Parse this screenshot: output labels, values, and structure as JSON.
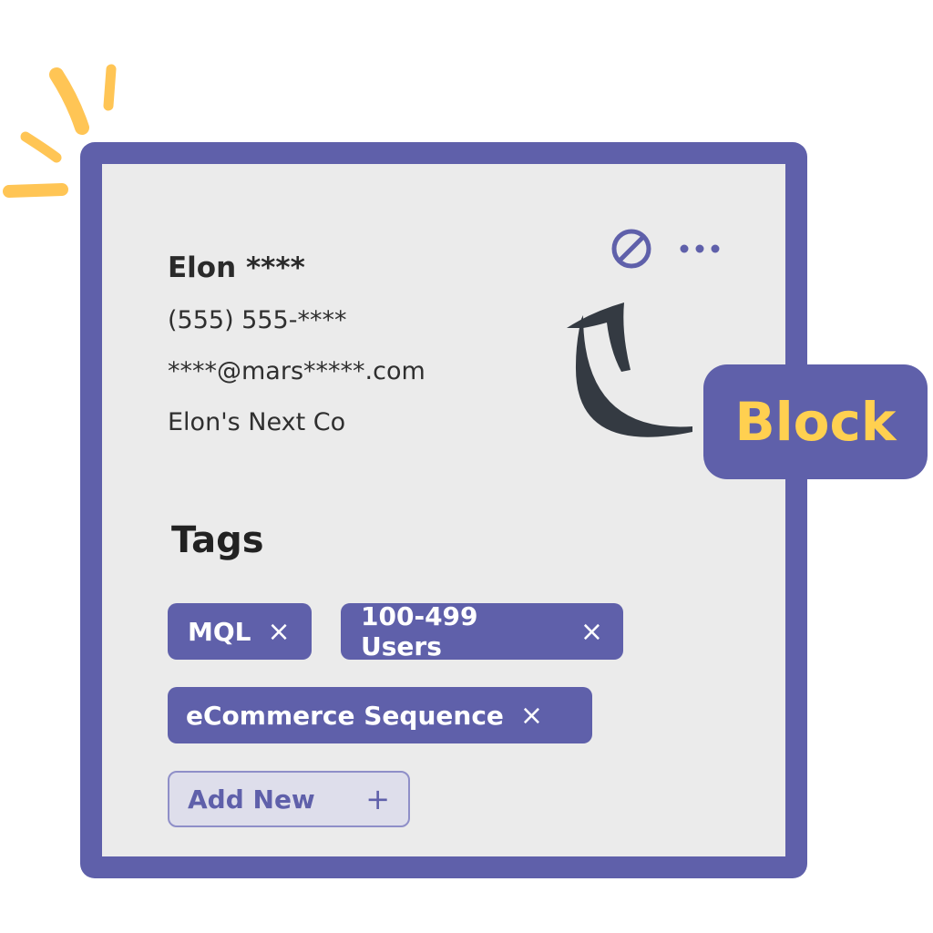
{
  "contact": {
    "name": "Elon ****",
    "phone": "(555) 555-****",
    "email": "****@mars*****.com",
    "company": "Elon's Next Co"
  },
  "actions": {
    "block_icon": "block-icon",
    "more_icon": "more-horizontal-icon"
  },
  "tags": {
    "title": "Tags",
    "items": [
      {
        "label": "MQL",
        "remove": "×"
      },
      {
        "label": "100-499 Users",
        "remove": "×"
      },
      {
        "label": "eCommerce Sequence",
        "remove": "×"
      }
    ],
    "add_label": "Add New",
    "add_icon": "+"
  },
  "callout": {
    "label": "Block"
  },
  "colors": {
    "accent": "#5f60aa",
    "highlight": "#ffc857",
    "arrow": "#343a42",
    "card_bg": "#ebebeb"
  }
}
